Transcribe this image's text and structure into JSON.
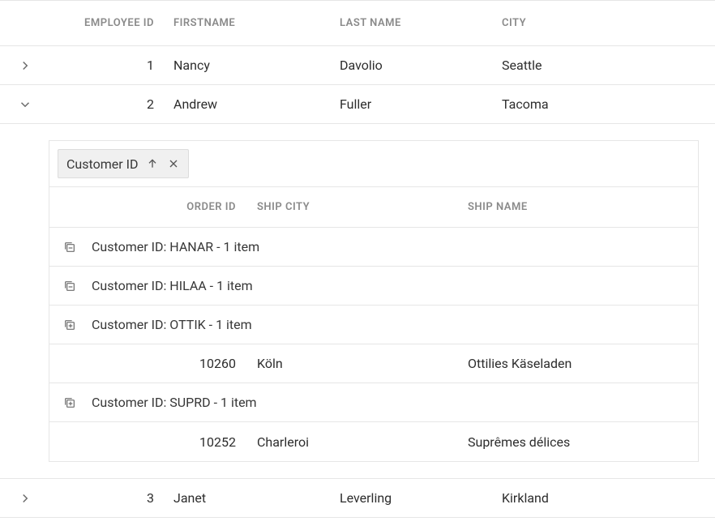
{
  "headers": {
    "employee_id": "EMPLOYEE ID",
    "firstname": "FIRSTNAME",
    "lastname": "LAST NAME",
    "city": "CITY"
  },
  "rows": [
    {
      "id": "1",
      "first": "Nancy",
      "last": "Davolio",
      "city": "Seattle",
      "expanded": false
    },
    {
      "id": "2",
      "first": "Andrew",
      "last": "Fuller",
      "city": "Tacoma",
      "expanded": true
    },
    {
      "id": "3",
      "first": "Janet",
      "last": "Leverling",
      "city": "Kirkland",
      "expanded": false
    }
  ],
  "detail": {
    "group_chip": "Customer ID",
    "sub_headers": {
      "order_id": "ORDER ID",
      "ship_city": "SHIP CITY",
      "ship_name": "SHIP NAME"
    },
    "group_label_prefix": "Customer ID: ",
    "group_label_suffix_singular": " - 1 item",
    "groups": [
      {
        "customer": "HANAR",
        "expanded": false,
        "orders": []
      },
      {
        "customer": "HILAA",
        "expanded": false,
        "orders": []
      },
      {
        "customer": "OTTIK",
        "expanded": true,
        "orders": [
          {
            "order_id": "10260",
            "ship_city": "Köln",
            "ship_name": "Ottilies Käseladen"
          }
        ]
      },
      {
        "customer": "SUPRD",
        "expanded": true,
        "orders": [
          {
            "order_id": "10252",
            "ship_city": "Charleroi",
            "ship_name": "Suprêmes délices"
          }
        ]
      }
    ]
  }
}
